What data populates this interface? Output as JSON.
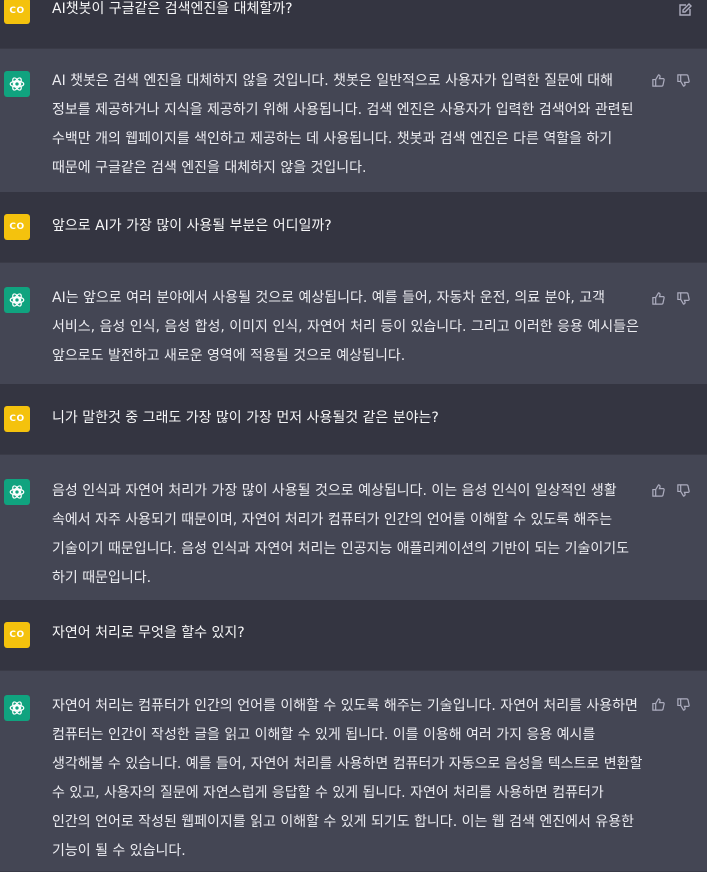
{
  "colors": {
    "user_bg": "#343541",
    "bot_bg": "#444654",
    "user_avatar": "#f4c20d",
    "bot_avatar": "#10a37f"
  },
  "user_avatar_label": "CO",
  "messages": [
    {
      "role": "user",
      "text": "AI챗봇이 구글같은 검색엔진을 대체할까?"
    },
    {
      "role": "assistant",
      "text": "AI 챗봇은 검색 엔진을 대체하지 않을 것입니다. 챗봇은 일반적으로 사용자가 입력한 질문에 대해 정보를 제공하거나 지식을 제공하기 위해 사용됩니다. 검색 엔진은 사용자가 입력한 검색어와 관련된 수백만 개의 웹페이지를 색인하고 제공하는 데 사용됩니다. 챗봇과 검색 엔진은 다른 역할을 하기 때문에 구글같은 검색 엔진을 대체하지 않을 것입니다."
    },
    {
      "role": "user",
      "text": "앞으로 AI가 가장 많이 사용될 부분은 어디일까?"
    },
    {
      "role": "assistant",
      "text": "AI는 앞으로 여러 분야에서 사용될 것으로 예상됩니다. 예를 들어, 자동차 운전, 의료 분야, 고객 서비스, 음성 인식, 음성 합성, 이미지 인식, 자연어 처리 등이 있습니다. 그리고 이러한 응용 예시들은 앞으로도 발전하고 새로운 영역에 적용될 것으로 예상됩니다."
    },
    {
      "role": "user",
      "text": "니가 말한것 중 그래도 가장 많이 가장 먼저 사용될것 같은 분야는?"
    },
    {
      "role": "assistant",
      "text": "음성 인식과 자연어 처리가 가장 많이 사용될 것으로 예상됩니다. 이는 음성 인식이 일상적인 생활 속에서 자주 사용되기 때문이며, 자연어 처리가 컴퓨터가 인간의 언어를 이해할 수 있도록 해주는 기술이기 때문입니다. 음성 인식과 자연어 처리는 인공지능 애플리케이션의 기반이 되는 기술이기도 하기 때문입니다."
    },
    {
      "role": "user",
      "text": "자연어 처리로 무엇을 할수 있지?"
    },
    {
      "role": "assistant",
      "text": "자연어 처리는 컴퓨터가 인간의 언어를 이해할 수 있도록 해주는 기술입니다. 자연어 처리를 사용하면 컴퓨터는 인간이 작성한 글을 읽고 이해할 수 있게 됩니다. 이를 이용해 여러 가지 응용 예시를 생각해볼 수 있습니다. 예를 들어, 자연어 처리를 사용하면 컴퓨터가 자동으로 음성을 텍스트로 변환할 수 있고, 사용자의 질문에 자연스럽게 응답할 수 있게 됩니다. 자연어 처리를 사용하면 컴퓨터가 인간의 언어로 작성된 웹페이지를 읽고 이해할 수 있게 되기도 합니다. 이는 웹 검색 엔진에서 유용한 기능이 될 수 있습니다."
    }
  ]
}
